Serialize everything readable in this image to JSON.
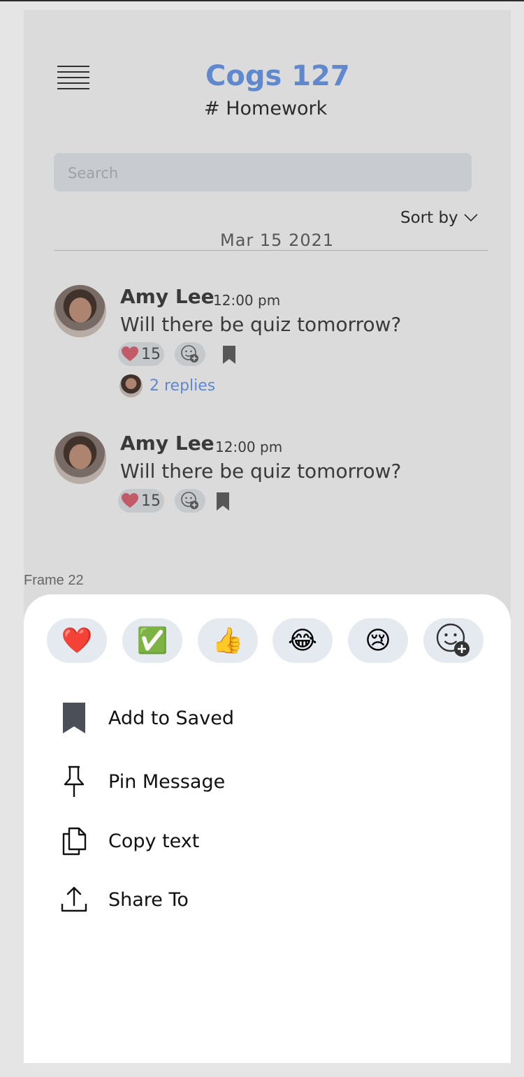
{
  "header": {
    "title": "Cogs 127",
    "channel": "# Homework"
  },
  "search": {
    "placeholder": "Search"
  },
  "sort": {
    "label": "Sort by"
  },
  "date_divider": "Mar 15 2021",
  "messages": [
    {
      "author": "Amy Lee",
      "time": "12:00 pm",
      "text": "Will there be quiz tomorrow?",
      "heart_count": "15",
      "replies": "2 replies"
    },
    {
      "author": "Amy Lee",
      "time": "12:00 pm",
      "text": "Will there be quiz tomorrow?",
      "heart_count": "15"
    }
  ],
  "frame_label": "Frame 22",
  "reactions": [
    {
      "emoji": "❤️",
      "icon": "heart-icon"
    },
    {
      "emoji": "✅",
      "icon": "check-mark-icon"
    },
    {
      "emoji": "👍",
      "icon": "thumbs-up-icon"
    },
    {
      "emoji": "😂",
      "icon": "laughing-icon"
    },
    {
      "emoji": "😢",
      "icon": "crying-icon"
    },
    {
      "emoji": "",
      "icon": "add-emoji-icon"
    }
  ],
  "menu": [
    {
      "label": "Add to Saved",
      "icon": "bookmark-icon"
    },
    {
      "label": "Pin Message",
      "icon": "pin-icon"
    },
    {
      "label": "Copy text",
      "icon": "copy-icon"
    },
    {
      "label": "Share To",
      "icon": "share-icon"
    }
  ],
  "colors": {
    "accent": "#6f9ff0",
    "pill_bg": "#e5eaf0",
    "overlay": "rgba(0,0,0,0.14)"
  }
}
